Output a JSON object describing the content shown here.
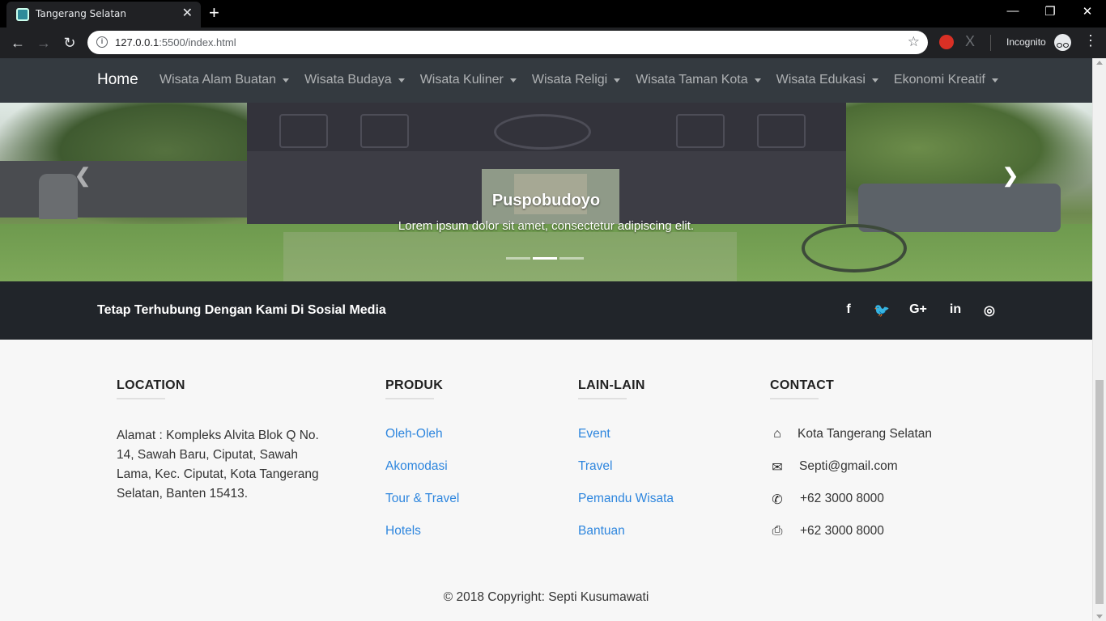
{
  "browser": {
    "tab_title": "Tangerang Selatan",
    "url_host": "127.0.0.1",
    "url_path": ":5500/index.html",
    "incognito_label": "Incognito"
  },
  "nav": {
    "brand": "Home",
    "items": [
      {
        "label": "Wisata Alam Buatan"
      },
      {
        "label": "Wisata Budaya"
      },
      {
        "label": "Wisata Kuliner"
      },
      {
        "label": "Wisata Religi"
      },
      {
        "label": "Wisata Taman Kota"
      },
      {
        "label": "Wisata Edukasi"
      },
      {
        "label": "Ekonomi Kreatif"
      }
    ]
  },
  "carousel": {
    "caption_title": "Puspobudoyo",
    "caption_text": "Lorem ipsum dolor sit amet, consectetur adipiscing elit.",
    "slide_count": 3,
    "active_index": 1
  },
  "social": {
    "heading": "Tetap Terhubung Dengan Kami Di Sosial Media",
    "icons": [
      "facebook-icon",
      "twitter-icon",
      "google-plus-icon",
      "linkedin-icon",
      "instagram-icon"
    ],
    "icon_glyphs": [
      "f",
      "🐦",
      "G+",
      "in",
      "◎"
    ]
  },
  "footer": {
    "location": {
      "title": "LOCATION",
      "address": "Alamat : Kompleks Alvita Blok Q No. 14, Sawah Baru, Ciputat, Sawah Lama, Kec. Ciputat, Kota Tangerang Selatan, Banten 15413."
    },
    "produk": {
      "title": "PRODUK",
      "links": [
        "Oleh-Oleh",
        "Akomodasi",
        "Tour & Travel",
        "Hotels"
      ]
    },
    "lain": {
      "title": "LAIN-LAIN",
      "links": [
        "Event",
        "Travel",
        "Pemandu Wisata",
        "Bantuan"
      ]
    },
    "contact": {
      "title": "CONTACT",
      "city": "Kota Tangerang Selatan",
      "email": "Septi@gmail.com",
      "phone": "+62 3000 8000",
      "fax": "+62 3000 8000"
    },
    "copyright": "© 2018 Copyright: Septi Kusumawati"
  },
  "colors": {
    "navbar": "#343a40",
    "social_strip": "#21252a",
    "link": "#2e86de",
    "footer_bg": "#f7f7f7"
  }
}
